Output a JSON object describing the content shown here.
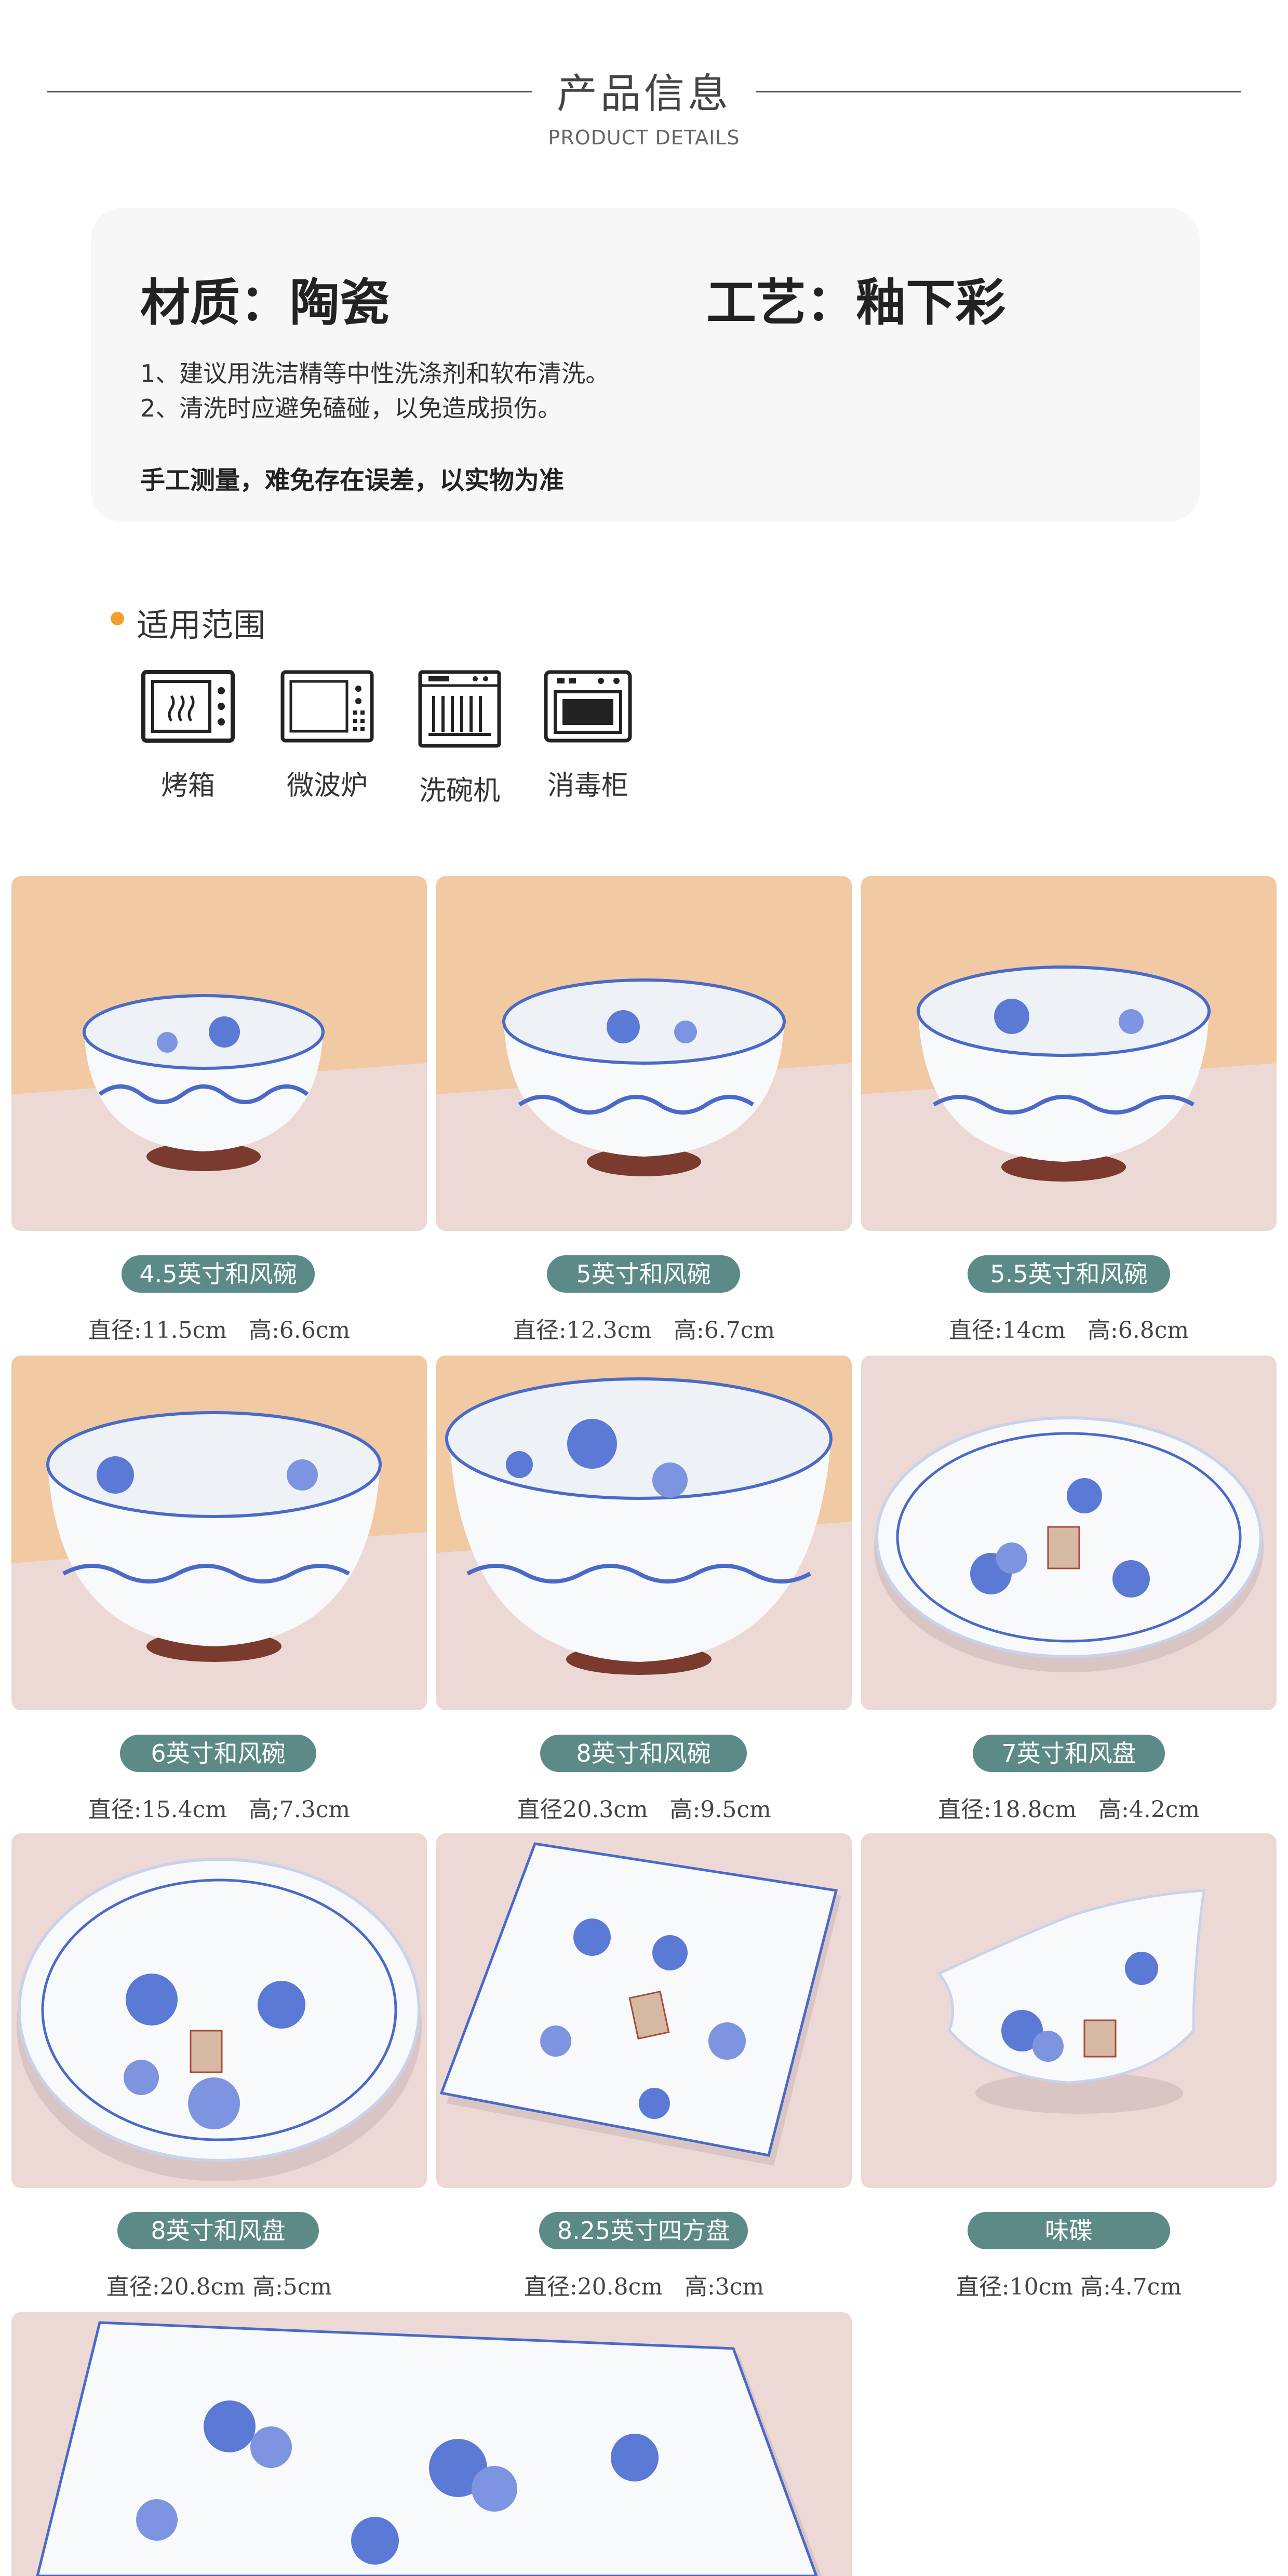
{
  "header": {
    "title": "产品信息",
    "subtitle": "PRODUCT DETAILS"
  },
  "info": {
    "material": "材质：陶瓷",
    "craft": "工艺：釉下彩",
    "care_1": "1、建议用洗洁精等中性洗涤剂和软布清洗。",
    "care_2": "2、清洗时应避免磕碰，以免造成损伤。",
    "measure_note": "手工测量，难免存在误差，以实物为准"
  },
  "usage": {
    "title": "适用范围",
    "items": [
      {
        "label": "烤箱",
        "icon": "oven-icon"
      },
      {
        "label": "微波炉",
        "icon": "microwave-icon"
      },
      {
        "label": "洗碗机",
        "icon": "dishwasher-icon"
      },
      {
        "label": "消毒柜",
        "icon": "sterilizer-cabinet-icon"
      }
    ]
  },
  "colors": {
    "accent_dot": "#f0a030",
    "pill": "#5c8a86",
    "pattern_blue": "#4a6ac8",
    "bg_peach": "#f1c9a3",
    "bg_pink": "#ecd9d6"
  },
  "products": [
    {
      "name": "4.5英寸和风碗",
      "dims": "直径:11.5cm   高:6.6cm"
    },
    {
      "name": "5英寸和风碗",
      "dims": "直径:12.3cm   高:6.7cm"
    },
    {
      "name": "5.5英寸和风碗",
      "dims": "直径:14cm   高:6.8cm"
    },
    {
      "name": "6英寸和风碗",
      "dims": "直径:15.4cm   高;7.3cm"
    },
    {
      "name": "8英寸和风碗",
      "dims": "直径20.3cm   高:9.5cm"
    },
    {
      "name": "7英寸和风盘",
      "dims": "直径:18.8cm   高:4.2cm"
    },
    {
      "name": "8英寸和风盘",
      "dims": "直径:20.8cm 高:5cm"
    },
    {
      "name": "8.25英寸四方盘",
      "dims": "直径:20.8cm   高:3cm"
    },
    {
      "name": "味碟",
      "dims": "直径:10cm 高:4.7cm"
    }
  ]
}
